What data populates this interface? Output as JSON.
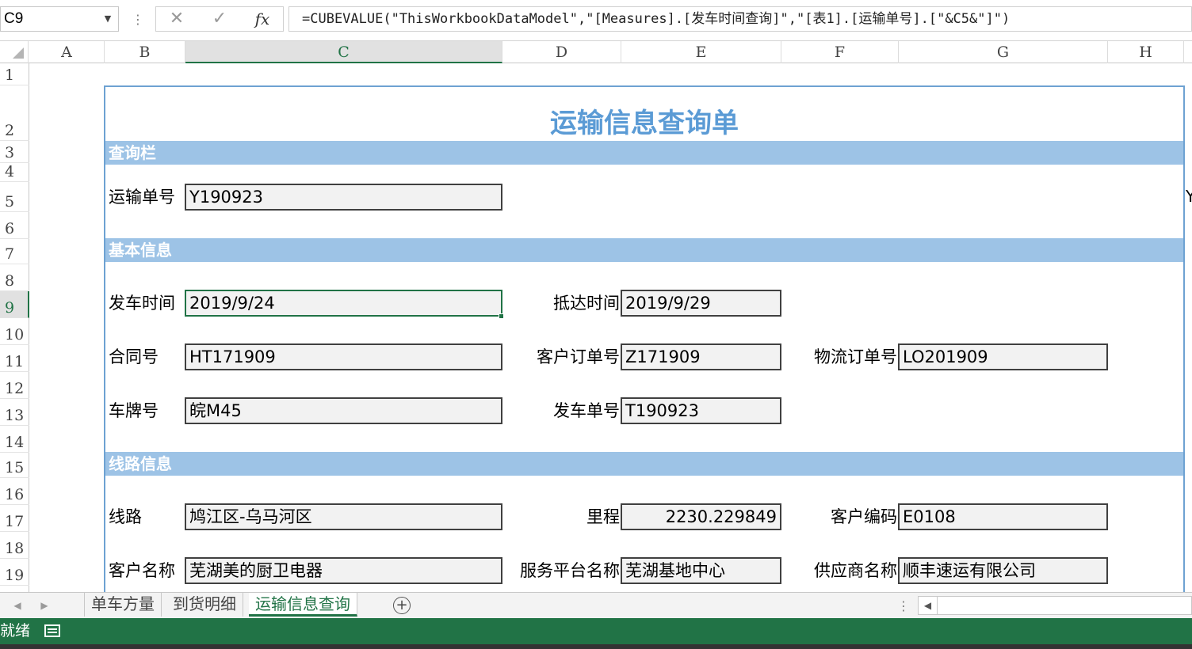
{
  "formula_bar": {
    "name_box": "C9",
    "cancel_icon": "close-icon",
    "enter_icon": "check-icon",
    "fx_label": "fx",
    "formula": "=CUBEVALUE(\"ThisWorkbookDataModel\",\"[Measures].[发车时间查询]\",\"[表1].[运输单号].[\"&C5&\"]\")"
  },
  "columns": [
    "A",
    "B",
    "C",
    "D",
    "E",
    "F",
    "G",
    "H"
  ],
  "active_column": "C",
  "rows": [
    "1",
    "2",
    "3",
    "4",
    "5",
    "6",
    "7",
    "8",
    "9",
    "10",
    "11",
    "12",
    "13",
    "14",
    "15",
    "16",
    "17",
    "18",
    "19"
  ],
  "active_row": "9",
  "sheet": {
    "title": "运输信息查询单",
    "sections": {
      "query": "查询栏",
      "basic": "基本信息",
      "route": "线路信息"
    },
    "query": {
      "waybill_label": "运输单号",
      "waybill_value": "Y190923"
    },
    "basic": {
      "depart_time_label": "发车时间",
      "depart_time_value": "2019/9/24",
      "arrive_time_label": "抵达时间",
      "arrive_time_value": "2019/9/29",
      "contract_label": "合同号",
      "contract_value": "HT171909",
      "customer_order_label": "客户订单号",
      "customer_order_value": "Z171909",
      "logistics_order_label": "物流订单号",
      "logistics_order_value": "LO201909",
      "plate_label": "车牌号",
      "plate_value": "皖M45",
      "depart_no_label": "发车单号",
      "depart_no_value": "T190923"
    },
    "route": {
      "route_label": "线路",
      "route_value": "鸠江区-乌马河区",
      "mileage_label": "里程",
      "mileage_value": "2230.229849",
      "customer_code_label": "客户编码",
      "customer_code_value": "E0108",
      "customer_name_label": "客户名称",
      "customer_name_value": "芜湖美的厨卫电器",
      "platform_label": "服务平台名称",
      "platform_value": "芜湖基地中心",
      "supplier_label": "供应商名称",
      "supplier_value": "顺丰速运有限公司"
    },
    "edge_char": "Y"
  },
  "tabs": [
    {
      "label": "单车方量",
      "active": false
    },
    {
      "label": "到货明细",
      "active": false
    },
    {
      "label": "运输信息查询",
      "active": true
    }
  ],
  "status": {
    "text": "就绪"
  },
  "colors": {
    "excel_green": "#217346",
    "title_blue": "#5b9bd5",
    "band_blue": "#9dc3e6",
    "field_gray": "#f2f2f2"
  }
}
